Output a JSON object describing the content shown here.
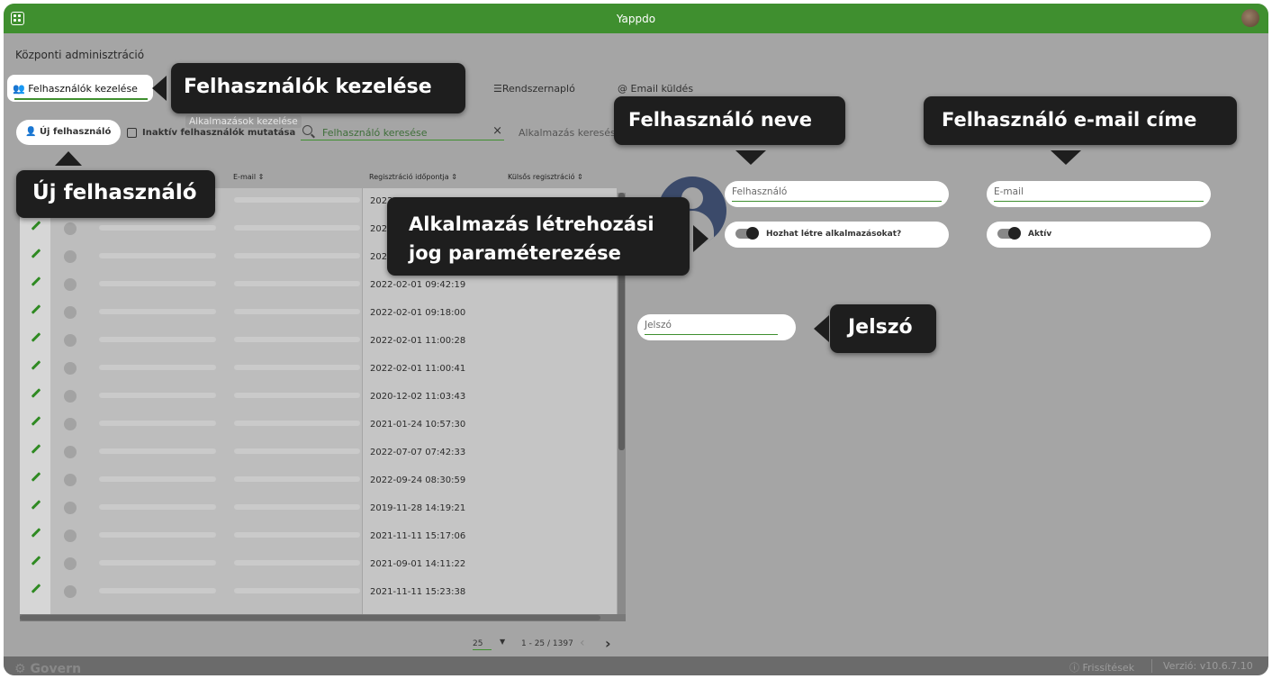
{
  "app": {
    "title": "Yappdo",
    "brand": "Govern",
    "accent": "#3f8f2f"
  },
  "page_title": "Központi adminisztráció",
  "tabs": [
    {
      "label": "Felhasználók kezelése",
      "active": true
    },
    {
      "label": "Rendszernapló"
    },
    {
      "label": "Email küldés"
    }
  ],
  "ghost_tab": "Alkalmazások kezelése",
  "toolbar": {
    "new_user": "Új felhasználó",
    "inactive_label": "Inaktív felhasználók mutatása",
    "search_placeholder": "Felhasználó keresése",
    "app_search_placeholder": "Alkalmazás keresése"
  },
  "table": {
    "headers": [
      "E-mail ⇕",
      "Regisztráció időpontja ⇕",
      "Külsős regisztráció ⇕"
    ],
    "dates": [
      "2022",
      "2022",
      "2022",
      "2022-02-01 09:42:19",
      "2022-02-01 09:18:00",
      "2022-02-01 11:00:28",
      "2022-02-01 11:00:41",
      "2020-12-02 11:03:43",
      "2021-01-24 10:57:30",
      "2022-07-07 07:42:33",
      "2022-09-24 08:30:59",
      "2019-11-28 14:19:21",
      "2021-11-11 15:17:06",
      "2021-09-01 14:11:22",
      "2021-11-11 15:23:38"
    ]
  },
  "pager": {
    "page_size": "25",
    "range": "1 - 25 / 1397"
  },
  "form": {
    "name_placeholder": "Felhasználó",
    "email_placeholder": "E-mail",
    "can_create_label": "Hozhat létre alkalmazásokat?",
    "active_label": "Aktív",
    "password_placeholder": "Jelszó"
  },
  "callouts": {
    "users_tab": "Felhasználók kezelése",
    "new_user": "Új felhasználó",
    "user_name": "Felhasználó neve",
    "user_email": "Felhasználó e-mail címe",
    "app_right": "Alkalmazás létrehozási jog paraméterezése",
    "password": "Jelszó"
  },
  "footer": {
    "updates": "Frissítések",
    "version": "Verzió: v10.6.7.10"
  }
}
